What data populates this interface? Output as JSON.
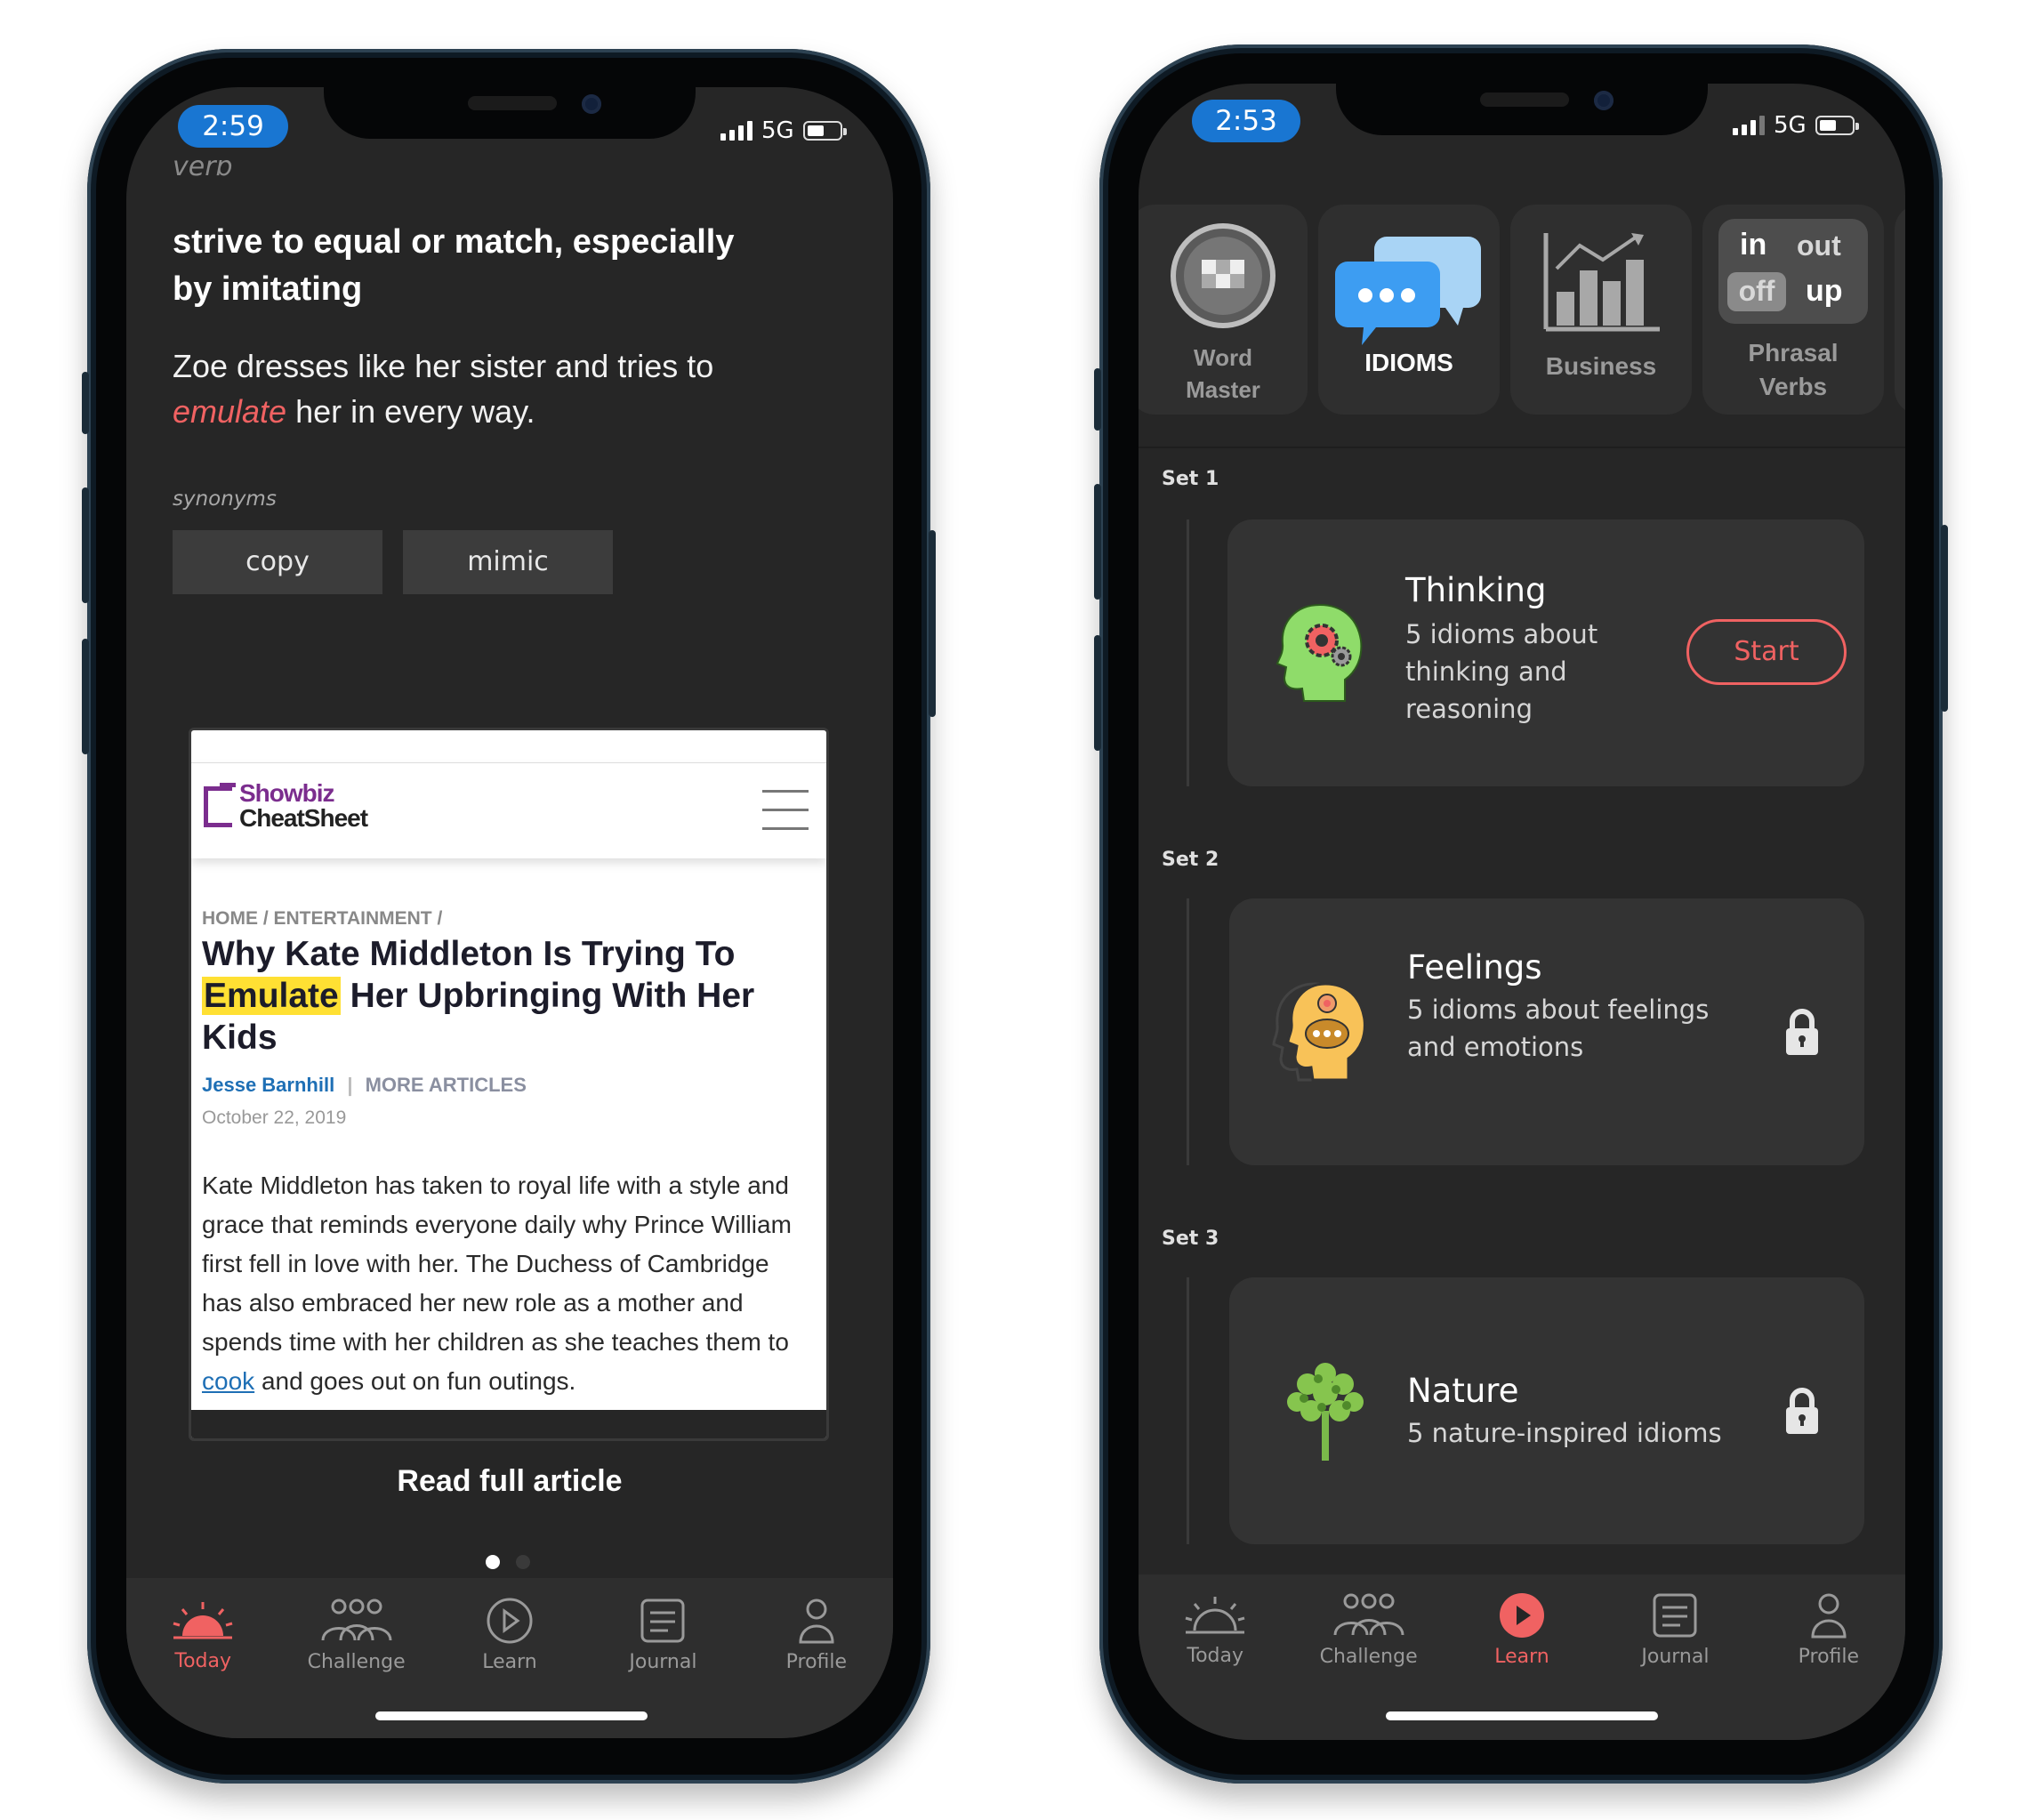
{
  "left_phone": {
    "status": {
      "time": "2:59",
      "network": "5G"
    },
    "word_type": "verb",
    "definition": "strive to equal or match, especially by imitating",
    "example": {
      "before": "Zoe dresses like her sister and tries to",
      "highlight": "emulate",
      "after": "her in every way."
    },
    "synonyms_label": "synonyms",
    "synonyms": [
      "copy",
      "mimic"
    ],
    "article": {
      "site_name_top": "Showbiz",
      "site_name_bottom": "CheatSheet",
      "breadcrumb": "HOME / ENTERTAINMENT /",
      "headline_before": "Why Kate Middleton Is Trying To",
      "headline_highlight": "Emulate",
      "headline_after": "Her Upbringing With Her Kids",
      "author": "Jesse Barnhill",
      "more_articles": "MORE ARTICLES",
      "date": "October 22, 2019",
      "body_before": "Kate Middleton has taken to royal life with a style and grace that reminds everyone daily why Prince William first fell in love with her. The Duchess of Cambridge has also embraced her new role as a mother and spends time with her children as she teaches them to",
      "body_link": "cook",
      "body_after": "and goes out on fun outings."
    },
    "read_full_article": "Read full article",
    "tabs": [
      {
        "label": "Today",
        "icon": "sunrise-icon",
        "active": true
      },
      {
        "label": "Challenge",
        "icon": "group-icon",
        "active": false
      },
      {
        "label": "Learn",
        "icon": "play-icon",
        "active": false
      },
      {
        "label": "Journal",
        "icon": "journal-icon",
        "active": false
      },
      {
        "label": "Profile",
        "icon": "profile-icon",
        "active": false
      }
    ]
  },
  "right_phone": {
    "status": {
      "time": "2:53",
      "network": "5G"
    },
    "categories": [
      {
        "label_line1": "Word",
        "label_line2": "Master",
        "icon": "word-master-icon"
      },
      {
        "label_line1": "IDIOMS",
        "label_line2": "",
        "icon": "speech-bubbles-icon"
      },
      {
        "label_line1": "Business",
        "label_line2": "",
        "icon": "bar-chart-icon"
      },
      {
        "label_line1": "Phrasal",
        "label_line2": "Verbs",
        "icon": "phrasal-verbs-icon",
        "words": [
          "in",
          "out",
          "off",
          "up"
        ]
      }
    ],
    "sets": [
      {
        "label": "Set 1",
        "title": "Thinking",
        "desc": "5 idioms about thinking and reasoning",
        "action": "Start",
        "icon": "head-gears-icon"
      },
      {
        "label": "Set 2",
        "title": "Feelings",
        "desc": "5 idioms about feelings and emotions",
        "icon": "head-emotions-icon",
        "locked": true
      },
      {
        "label": "Set 3",
        "title": "Nature",
        "desc": "5 nature-inspired idioms",
        "icon": "tree-icon",
        "locked": true
      }
    ],
    "tabs": [
      {
        "label": "Today",
        "icon": "sunrise-icon",
        "active": false
      },
      {
        "label": "Challenge",
        "icon": "group-icon",
        "active": false
      },
      {
        "label": "Learn",
        "icon": "play-icon",
        "active": true
      },
      {
        "label": "Journal",
        "icon": "journal-icon",
        "active": false
      },
      {
        "label": "Profile",
        "icon": "profile-icon",
        "active": false
      }
    ]
  },
  "colors": {
    "accent": "#f06262",
    "background": "#262626",
    "card": "#333333",
    "time_pill": "#1976d2",
    "highlight": "#ffe033"
  }
}
